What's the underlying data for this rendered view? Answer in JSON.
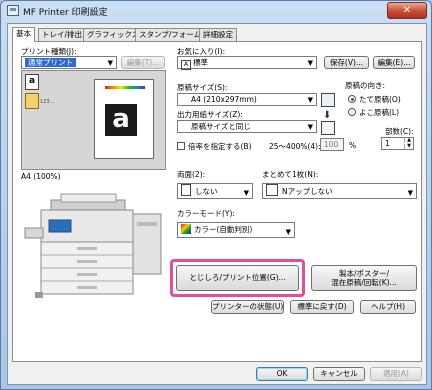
{
  "window": {
    "title": "MF Printer 印刷設定",
    "close_glyph": "✕"
  },
  "tabs": [
    {
      "label": "基本",
      "active": true
    },
    {
      "label": "トレイ/排出",
      "active": false
    },
    {
      "label": "グラフィックス",
      "active": false
    },
    {
      "label": "スタンプ/フォーム",
      "active": false
    },
    {
      "label": "詳細設定",
      "active": false
    }
  ],
  "job_type": {
    "label": "プリント種類(J):",
    "value": "通常プリント",
    "edit_button": "編集(T)..."
  },
  "favorites": {
    "label": "お気に入り(I):",
    "value": "標準",
    "save_button": "保存(V)...",
    "edit_button": "編集(E)..."
  },
  "preview": {
    "caption": "A4 (100%)",
    "paper_letter": "a",
    "stack_numbers": "123..."
  },
  "paper_size": {
    "label": "原稿サイズ(S):",
    "value": "A4 (210x297mm)"
  },
  "output_size": {
    "label": "出力用紙サイズ(Z):",
    "value": "原稿サイズと同じ"
  },
  "zoom": {
    "checkbox_label": "倍率を指定する(B)",
    "range": "25〜400%(4):",
    "value": "100",
    "unit": "%"
  },
  "orientation": {
    "label": "原稿の向き:",
    "options": [
      "たて原稿(O)",
      "よこ原稿(L)"
    ],
    "selected_index": 0
  },
  "copies": {
    "label": "部数(C):",
    "value": "1"
  },
  "duplex": {
    "label": "両面(2):",
    "value": "しない"
  },
  "nup": {
    "label": "まとめて1枚(N):",
    "value": "Nアップしない"
  },
  "color_mode": {
    "label": "カラーモード(Y):",
    "value": "カラー(自動判別)"
  },
  "actions": {
    "binding_button": "とじしろ/プリント位置(G)...",
    "booklet_button_line1": "製本/ポスター/",
    "booklet_button_line2": "混在原稿/回転(K)...",
    "printer_status_button": "プリンターの状態(U)",
    "restore_default_button": "標準に戻す(D)",
    "help_button": "ヘルプ(H)"
  },
  "footer": {
    "ok": "OK",
    "cancel": "キャンセル",
    "apply": "適用(A)"
  },
  "colors": {
    "highlight": "#e04ea0",
    "selection": "#2d6bd3",
    "close": "#c64b34"
  }
}
